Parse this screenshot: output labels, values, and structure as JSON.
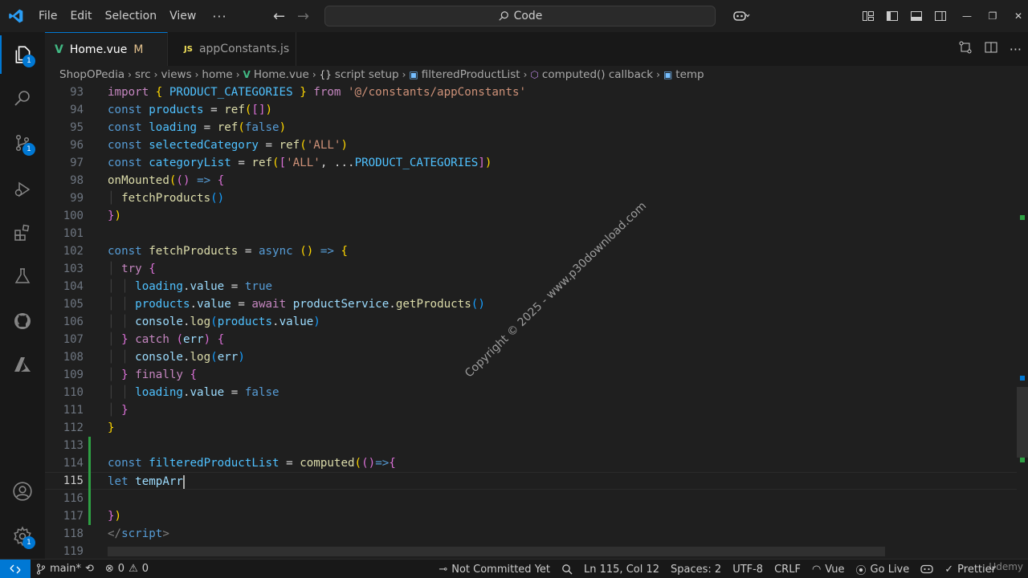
{
  "titlebar": {
    "menu": [
      "File",
      "Edit",
      "Selection",
      "View"
    ],
    "more": "···",
    "search": "Code"
  },
  "tabs": [
    {
      "label": "Home.vue",
      "status": "M",
      "icon": "vue-icon",
      "active": true
    },
    {
      "label": "appConstants.js",
      "icon": "js-icon",
      "active": false
    }
  ],
  "breadcrumb": [
    "ShopOPedia",
    "src",
    "views",
    "home",
    "Home.vue",
    "script setup",
    "filteredProductList",
    "computed() callback",
    "temp"
  ],
  "breadcrumb_prefix": "{}",
  "activity_badges": {
    "explorer": "1",
    "scm": "1",
    "settings": "1"
  },
  "editor": {
    "current_line": "115",
    "lines": [
      {
        "n": "93"
      },
      {
        "n": "94"
      },
      {
        "n": "95"
      },
      {
        "n": "96"
      },
      {
        "n": "97"
      },
      {
        "n": "98"
      },
      {
        "n": "99"
      },
      {
        "n": "100"
      },
      {
        "n": "101"
      },
      {
        "n": "102"
      },
      {
        "n": "103"
      },
      {
        "n": "104"
      },
      {
        "n": "105"
      },
      {
        "n": "106"
      },
      {
        "n": "107"
      },
      {
        "n": "108"
      },
      {
        "n": "109"
      },
      {
        "n": "110"
      },
      {
        "n": "111"
      },
      {
        "n": "112"
      },
      {
        "n": "113"
      },
      {
        "n": "114"
      },
      {
        "n": "115"
      },
      {
        "n": "116"
      },
      {
        "n": "117"
      },
      {
        "n": "118"
      },
      {
        "n": "119"
      }
    ]
  },
  "watermark": "Copyright © 2025 - www.p30download.com",
  "statusbar": {
    "branch": "main*",
    "errors": "0",
    "warnings": "0",
    "commit": "Not Committed Yet",
    "position": "Ln 115, Col 12",
    "spaces": "Spaces: 2",
    "encoding": "UTF-8",
    "eol": "CRLF",
    "language": "Vue",
    "golive": "Go Live",
    "prettier": "Prettier"
  },
  "overlay_brand": "Udemy",
  "colors": {
    "accent": "#0078d4",
    "added": "#2ea043",
    "modified": "#e2c08d"
  }
}
